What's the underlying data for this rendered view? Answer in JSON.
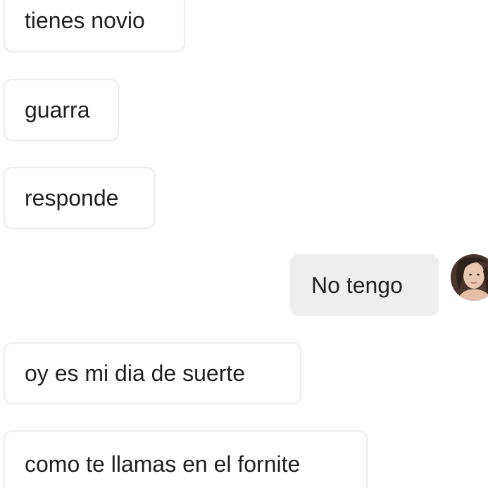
{
  "chat": {
    "messages": [
      {
        "sender": "other",
        "text": "tienes novio"
      },
      {
        "sender": "other",
        "text": "guarra"
      },
      {
        "sender": "other",
        "text": "responde"
      },
      {
        "sender": "me",
        "text": "No tengo"
      },
      {
        "sender": "other",
        "text": "oy es mi dia de suerte"
      },
      {
        "sender": "other",
        "text": "como te llamas en el fornite"
      }
    ],
    "avatar_icon": "user-avatar-photo",
    "colors": {
      "incoming_bubble": "#ffffff",
      "incoming_border": "#ececec",
      "outgoing_bubble": "#eeeeef",
      "text": "#1f1f1f",
      "background": "#ffffff"
    }
  }
}
